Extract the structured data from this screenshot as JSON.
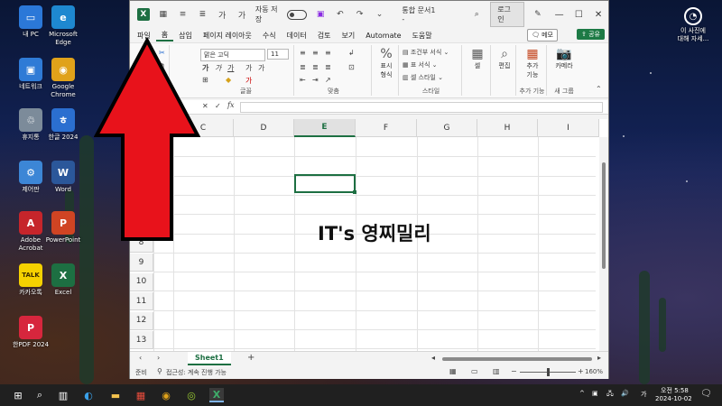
{
  "desktop": {
    "icons": [
      {
        "label": "내 PC",
        "color": "#2b78d8",
        "glyph": "▭"
      },
      {
        "label": "Microsoft\nEdge",
        "color": "#1e88d0",
        "glyph": "e"
      },
      {
        "label": "네트워크",
        "color": "#2f7bd6",
        "glyph": "▣"
      },
      {
        "label": "Google\nChrome",
        "color": "#e0a21a",
        "glyph": "◉"
      },
      {
        "label": "휴지통",
        "color": "#7c8b9a",
        "glyph": "♲"
      },
      {
        "label": "한글 2024",
        "color": "#2b6fd0",
        "glyph": "ㅎ"
      },
      {
        "label": "제어판",
        "color": "#3c86d6",
        "glyph": "⚙"
      },
      {
        "label": "Word",
        "color": "#2b579a",
        "glyph": "W"
      },
      {
        "label": "Adobe\nAcrobat",
        "color": "#c6252b",
        "glyph": "A"
      },
      {
        "label": "PowerPoint",
        "color": "#d04423",
        "glyph": "P"
      },
      {
        "label": "카카오톡",
        "color": "#f5d100",
        "glyph": "TALK"
      },
      {
        "label": "Excel",
        "color": "#1d6f42",
        "glyph": "X"
      },
      {
        "label": "한PDF 2024",
        "color": "#d7263d",
        "glyph": "P"
      }
    ],
    "right_icon": {
      "label": "이 사진에\n대해 자세..."
    }
  },
  "excel": {
    "autosave_label": "자동 저장",
    "autosave_state": "끔",
    "doc_title": "통합 문서1 -",
    "login_label": "로그인",
    "menu": [
      "파일",
      "홈",
      "삽입",
      "페이지 레이아웃",
      "수식",
      "데이터",
      "검토",
      "보기",
      "Automate",
      "도움말"
    ],
    "memo_label": "메모",
    "share_label": "공유",
    "ribbon": {
      "font_name": "맑은 고딕",
      "font_size": "11",
      "font_group": "글꼴",
      "align_group": "맞춤",
      "number_format": "표시\n형식",
      "style_group": "스타일",
      "conditional": "조건부 서식",
      "table_format": "표 서식",
      "cell_style": "셀 스타일",
      "cell_btn": "셀",
      "edit_btn": "편집",
      "addin_btn": "추가\n기능",
      "addin_group": "추가 기능",
      "camera_btn": "카메라",
      "new_group": "새 그룹"
    },
    "columns": [
      "C",
      "D",
      "E",
      "F",
      "G",
      "H",
      "I"
    ],
    "selected_column": "E",
    "rows": [
      "8",
      "9",
      "10",
      "11",
      "12",
      "13",
      "14"
    ],
    "watermark": "IT's 영찌밀리",
    "sheet_tab": "Sheet1",
    "status_ready": "준비",
    "accessibility": "접근성: 계속 진행 가능",
    "zoom": "160%"
  },
  "taskbar": {
    "time_ampm": "오전 5:58",
    "date": "2024-10-02",
    "ime": "가"
  }
}
